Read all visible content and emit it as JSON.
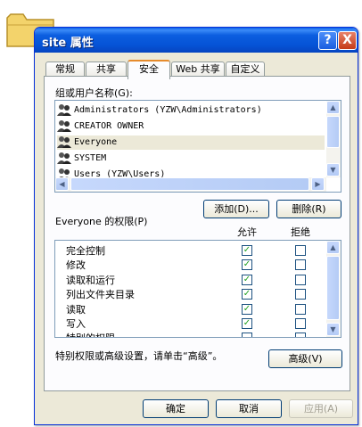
{
  "window": {
    "title": "site 属性",
    "help_label": "?",
    "close_label": "X"
  },
  "tabs": [
    {
      "label": "常规"
    },
    {
      "label": "共享"
    },
    {
      "label": "安全"
    },
    {
      "label": "Web 共享"
    },
    {
      "label": "自定义"
    }
  ],
  "active_tab": "安全",
  "users": {
    "label": "组或用户名称(G):",
    "items": [
      {
        "label": "Administrators (YZW\\Administrators)"
      },
      {
        "label": "CREATOR OWNER"
      },
      {
        "label": "Everyone"
      },
      {
        "label": "SYSTEM"
      },
      {
        "label": "Users (YZW\\Users)"
      }
    ],
    "selected": "Everyone"
  },
  "buttons": {
    "add": "添加(D)...",
    "remove": "删除(R)",
    "advanced": "高级(V)",
    "ok": "确定",
    "cancel": "取消",
    "apply": "应用(A)"
  },
  "permissions": {
    "title": "Everyone 的权限(P)",
    "allow_header": "允许",
    "deny_header": "拒绝",
    "rows": [
      {
        "label": "完全控制",
        "allow": true,
        "deny": false
      },
      {
        "label": "修改",
        "allow": true,
        "deny": false
      },
      {
        "label": "读取和运行",
        "allow": true,
        "deny": false
      },
      {
        "label": "列出文件夹目录",
        "allow": true,
        "deny": false
      },
      {
        "label": "读取",
        "allow": true,
        "deny": false
      },
      {
        "label": "写入",
        "allow": true,
        "deny": false
      },
      {
        "label": "特别的权限",
        "allow": false,
        "deny": false
      }
    ]
  },
  "advanced_hint": "特别权限或高级设置，请单击“高级”。",
  "colors": {
    "titlebar": "#0553d6",
    "dialog_bg": "#ece9d8",
    "selection": "#ece9d8",
    "check": "#21a121"
  }
}
